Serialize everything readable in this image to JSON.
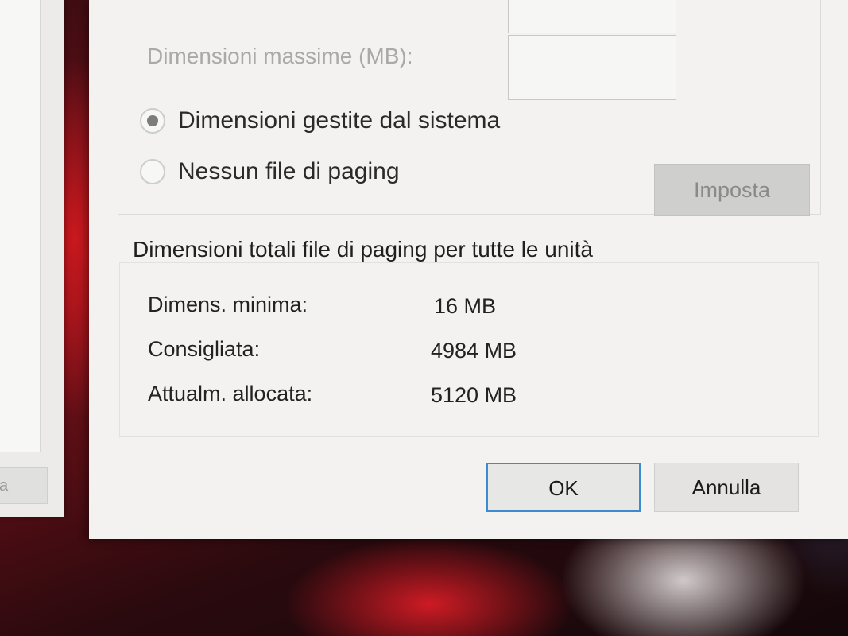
{
  "dialog": {
    "max_size_label": "Dimensioni massime (MB):",
    "radio_system_managed": "Dimensioni gestite dal sistema",
    "radio_no_paging": "Nessun file di paging",
    "set_button": "Imposta",
    "totals": {
      "title": "Dimensioni totali file di paging per tutte le unità",
      "rows": [
        {
          "label": "Dimens. minima:",
          "value": "16 MB"
        },
        {
          "label": "Consigliata:",
          "value": "4984 MB"
        },
        {
          "label": "Attualm. allocata:",
          "value": "5120 MB"
        }
      ]
    },
    "ok_button": "OK",
    "cancel_button": "Annulla"
  },
  "background_window": {
    "button_fragment": "a"
  }
}
